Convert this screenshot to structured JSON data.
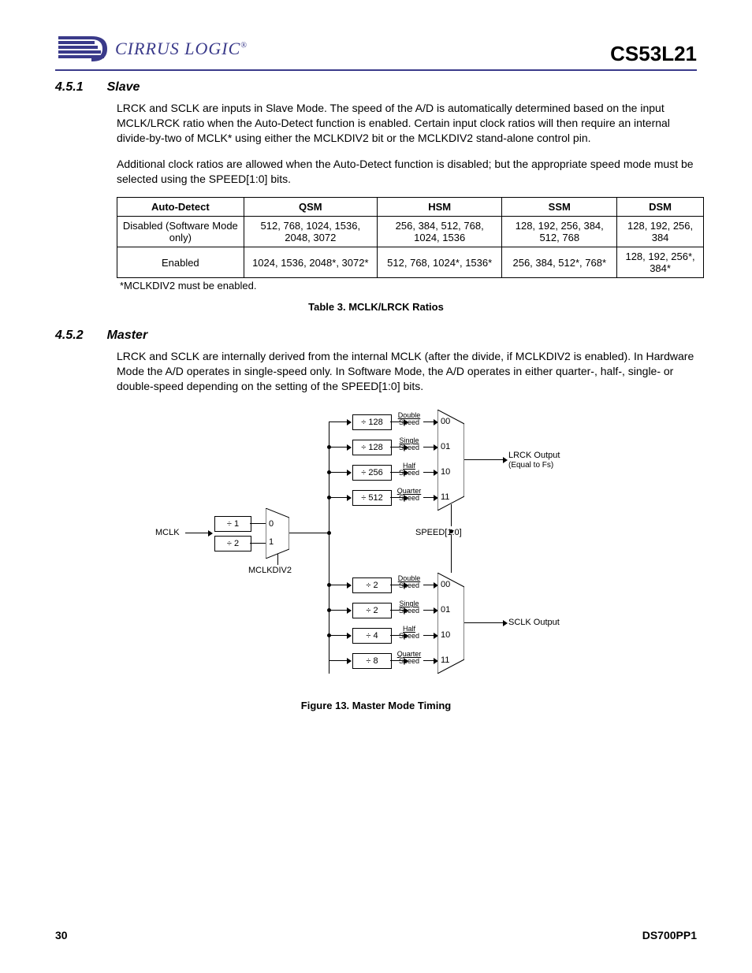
{
  "header": {
    "logo_text": "CIRRUS LOGIC",
    "part_number": "CS53L21"
  },
  "section_451": {
    "number": "4.5.1",
    "title": "Slave",
    "para1": "LRCK and SCLK are inputs in Slave Mode. The speed of the A/D is automatically determined based on the input MCLK/LRCK ratio when the Auto-Detect function is enabled. Certain input clock ratios will then require an internal divide-by-two of MCLK* using either the MCLKDIV2 bit or the MCLKDIV2 stand-alone control pin.",
    "para2": "Additional clock ratios are allowed when the Auto-Detect function is disabled; but the appropriate speed mode must be selected using the SPEED[1:0] bits."
  },
  "table3": {
    "headers": [
      "Auto-Detect",
      "QSM",
      "HSM",
      "SSM",
      "DSM"
    ],
    "rows": [
      {
        "auto": "Disabled (Software Mode only)",
        "qsm": "512, 768, 1024, 1536, 2048, 3072",
        "hsm": "256, 384, 512, 768, 1024, 1536",
        "ssm": "128, 192, 256, 384, 512, 768",
        "dsm": "128, 192, 256, 384"
      },
      {
        "auto": "Enabled",
        "qsm": "1024, 1536, 2048*, 3072*",
        "hsm": "512, 768, 1024*, 1536*",
        "ssm": "256, 384, 512*, 768*",
        "dsm": "128, 192, 256*, 384*"
      }
    ],
    "footnote": "*MCLKDIV2 must be enabled.",
    "caption": "Table 3. MCLK/LRCK Ratios"
  },
  "section_452": {
    "number": "4.5.2",
    "title": "Master",
    "para1": "LRCK and SCLK are internally derived from the internal MCLK (after the divide, if MCLKDIV2 is enabled). In Hardware Mode the A/D operates in single-speed only. In Software Mode, the A/D operates in either quarter-, half-, single- or double-speed depending on the setting of the SPEED[1:0] bits."
  },
  "figure13": {
    "caption": "Figure 13.  Master Mode Timing",
    "mclk": "MCLK",
    "div1": "÷ 1",
    "div2": "÷ 2",
    "mclkdiv2": "MCLKDIV2",
    "speed_signal": "SPEED[1:0]",
    "lrck_out": "LRCK Output",
    "lrck_sub": "(Equal to Fs)",
    "sclk_out": "SCLK Output",
    "top_divs": [
      "÷ 128",
      "÷ 128",
      "÷ 256",
      "÷ 512"
    ],
    "bot_divs": [
      "÷ 2",
      "÷ 2",
      "÷ 4",
      "÷ 8"
    ],
    "speeds": [
      "Double Speed",
      "Single Speed",
      "Half Speed",
      "Quarter Speed"
    ],
    "mux_codes": [
      "00",
      "01",
      "10",
      "11"
    ],
    "mux1_sel": [
      "0",
      "1"
    ]
  },
  "footer": {
    "page": "30",
    "docid": "DS700PP1"
  }
}
